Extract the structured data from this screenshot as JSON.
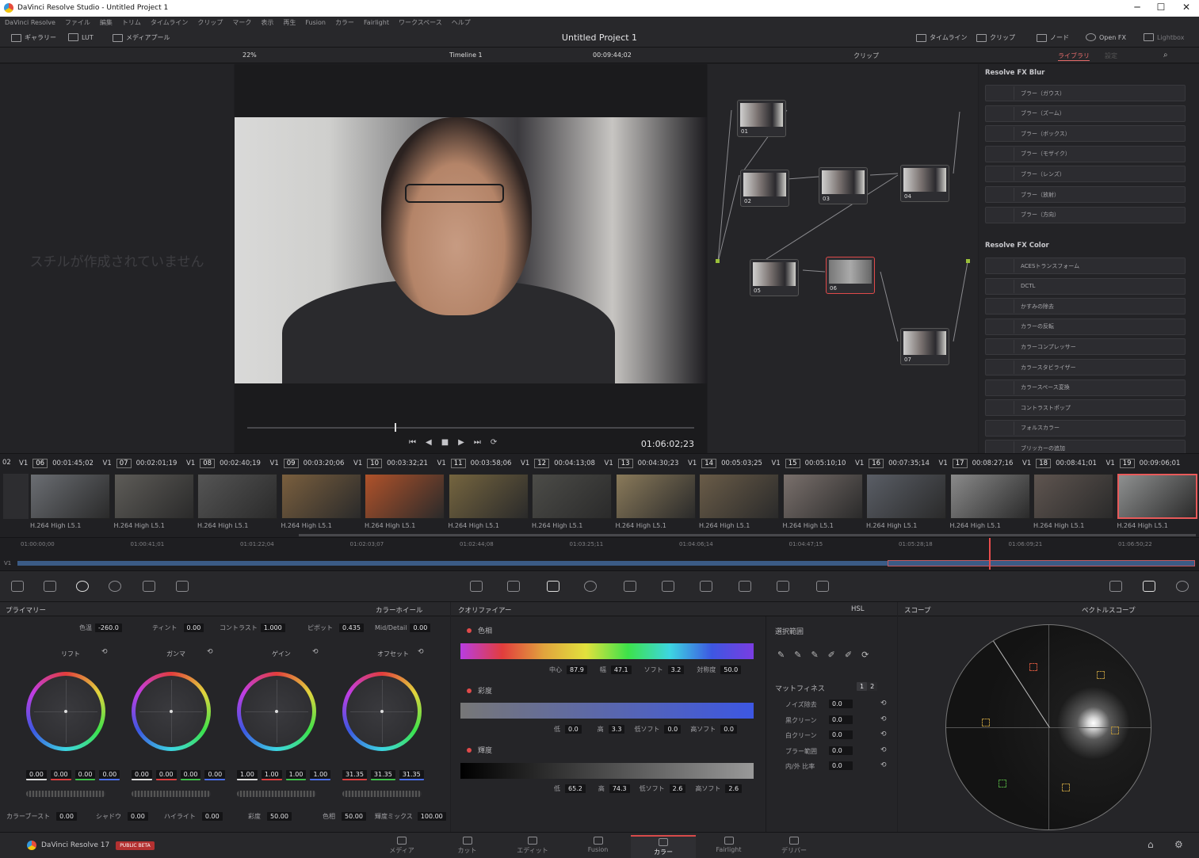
{
  "window": {
    "title": "DaVinci Resolve Studio - Untitled Project 1",
    "min": "─",
    "max": "☐",
    "close": "✕"
  },
  "menu": [
    "DaVinci Resolve",
    "ファイル",
    "編集",
    "トリム",
    "タイムライン",
    "クリップ",
    "マーク",
    "表示",
    "再生",
    "Fusion",
    "カラー",
    "Fairlight",
    "ワークスペース",
    "ヘルプ"
  ],
  "toolbar": {
    "gallery": "ギャラリー",
    "lut": "LUT",
    "media_pool": "メディアプール",
    "project_title": "Untitled Project 1",
    "timeline": "タイムライン",
    "clips": "クリップ",
    "nodes": "ノード",
    "openfx": "Open FX",
    "lightbox": "Lightbox"
  },
  "subbar": {
    "zoom": "22%",
    "timeline_name": "Timeline 1",
    "timecode": "00:09:44;02",
    "node_mode": "クリップ",
    "tab_library": "ライブラリ",
    "tab_settings": "設定"
  },
  "gallery": {
    "empty_message": "スチルが作成されていません"
  },
  "viewer": {
    "current_timecode": "01:06:02;23"
  },
  "nodes": [
    {
      "label": "01"
    },
    {
      "label": "02"
    },
    {
      "label": "03"
    },
    {
      "label": "04"
    },
    {
      "label": "05"
    },
    {
      "label": "06"
    },
    {
      "label": "07"
    }
  ],
  "library": {
    "blur_header": "Resolve FX Blur",
    "blur_items": [
      "ブラー（ガウス）",
      "ブラー（ズーム）",
      "ブラー（ボックス）",
      "ブラー（モザイク）",
      "ブラー（レンズ）",
      "ブラー（放射）",
      "ブラー（方向）"
    ],
    "color_header": "Resolve FX Color",
    "color_items": [
      "ACESトランスフォーム",
      "DCTL",
      "かすみの除去",
      "カラーの反転",
      "カラーコンプレッサー",
      "カラースタビライザー",
      "カラースペース変換",
      "コントラストポップ",
      "フォルスカラー",
      "ブリッカーの追加"
    ]
  },
  "clips": [
    {
      "track": "V1",
      "num": "06",
      "tc": "00:01:45;02",
      "codec": "H.264 High L5.1"
    },
    {
      "track": "V1",
      "num": "07",
      "tc": "00:02:01;19",
      "codec": "H.264 High L5.1"
    },
    {
      "track": "V1",
      "num": "08",
      "tc": "00:02:40;19",
      "codec": "H.264 High L5.1"
    },
    {
      "track": "V1",
      "num": "09",
      "tc": "00:03:20;06",
      "codec": "H.264 High L5.1"
    },
    {
      "track": "V1",
      "num": "10",
      "tc": "00:03:32;21",
      "codec": "H.264 High L5.1"
    },
    {
      "track": "V1",
      "num": "11",
      "tc": "00:03:58;06",
      "codec": "H.264 High L5.1"
    },
    {
      "track": "V1",
      "num": "12",
      "tc": "00:04:13;08",
      "codec": "H.264 High L5.1"
    },
    {
      "track": "V1",
      "num": "13",
      "tc": "00:04:30;23",
      "codec": "H.264 High L5.1"
    },
    {
      "track": "V1",
      "num": "14",
      "tc": "00:05:03;25",
      "codec": "H.264 High L5.1"
    },
    {
      "track": "V1",
      "num": "15",
      "tc": "00:05:10;10",
      "codec": "H.264 High L5.1"
    },
    {
      "track": "V1",
      "num": "16",
      "tc": "00:07:35;14",
      "codec": "H.264 High L5.1"
    },
    {
      "track": "V1",
      "num": "17",
      "tc": "00:08:27;16",
      "codec": "H.264 High L5.1"
    },
    {
      "track": "V1",
      "num": "18",
      "tc": "00:08:41;01",
      "codec": "H.264 High L5.1"
    },
    {
      "track": "V1",
      "num": "19",
      "tc": "00:09:06;01",
      "codec": "H.264 High L5.1"
    }
  ],
  "clip_prefix": "02",
  "mini_timeline": {
    "track": "V1",
    "ticks": [
      "01:00:00;00",
      "01:00:41;01",
      "01:01:22;04",
      "01:02:03;07",
      "01:02:44;08",
      "01:03:25;11",
      "01:04:06;14",
      "01:04:47;15",
      "01:05:28;18",
      "01:06:09;21",
      "01:06:50;22"
    ]
  },
  "primaries": {
    "title": "プライマリー",
    "mode": "カラーホイール",
    "temp_label": "色温",
    "temp": "-260.0",
    "tint_label": "ティント",
    "tint": "0.00",
    "contrast_label": "コントラスト",
    "contrast": "1.000",
    "pivot_label": "ピボット",
    "pivot": "0.435",
    "middetail_label": "Mid/Detail",
    "middetail": "0.00",
    "wheels": [
      {
        "name": "リフト",
        "values": [
          "0.00",
          "0.00",
          "0.00",
          "0.00"
        ]
      },
      {
        "name": "ガンマ",
        "values": [
          "0.00",
          "0.00",
          "0.00",
          "0.00"
        ]
      },
      {
        "name": "ゲイン",
        "values": [
          "1.00",
          "1.00",
          "1.00",
          "1.00"
        ]
      },
      {
        "name": "オフセット",
        "values": [
          "31.35",
          "31.35",
          "31.35"
        ]
      }
    ],
    "boost_label": "カラーブースト",
    "boost": "0.00",
    "shadow_label": "シャドウ",
    "shadow": "0.00",
    "highlight_label": "ハイライト",
    "highlight": "0.00",
    "sat_label": "彩度",
    "sat": "50.00",
    "hue_label": "色相",
    "hue": "50.00",
    "lummix_label": "輝度ミックス",
    "lummix": "100.00"
  },
  "qualifier": {
    "title": "クオリファイアー",
    "mode": "HSL",
    "hue_title": "色相",
    "hue": {
      "center_l": "中心",
      "center": "87.9",
      "width_l": "幅",
      "width": "47.1",
      "soft_l": "ソフト",
      "soft": "3.2",
      "sym_l": "対称度",
      "sym": "50.0"
    },
    "sat_title": "彩度",
    "sat": {
      "low_l": "低",
      "low": "0.0",
      "high_l": "高",
      "high": "3.3",
      "lsoft_l": "低ソフト",
      "lsoft": "0.0",
      "hsoft_l": "高ソフト",
      "hsoft": "0.0"
    },
    "lum_title": "輝度",
    "lum": {
      "low_l": "低",
      "low": "65.2",
      "high_l": "高",
      "high": "74.3",
      "lsoft_l": "低ソフト",
      "lsoft": "2.6",
      "hsoft_l": "高ソフト",
      "hsoft": "2.6"
    },
    "selection_title": "選択範囲",
    "matte_title": "マットフィネス",
    "matte_tabs": [
      "1",
      "2"
    ],
    "matte_rows": [
      {
        "label": "ノイズ除去",
        "value": "0.0"
      },
      {
        "label": "黒クリーン",
        "value": "0.0"
      },
      {
        "label": "白クリーン",
        "value": "0.0"
      },
      {
        "label": "ブラー範囲",
        "value": "0.0"
      },
      {
        "label": "内/外 比率",
        "value": "0.0"
      }
    ]
  },
  "scopes": {
    "title": "スコープ",
    "mode": "ベクトルスコープ"
  },
  "bottom": {
    "app": "DaVinci Resolve 17",
    "badge": "PUBLIC BETA",
    "pages": [
      "メディア",
      "カット",
      "エディット",
      "Fusion",
      "カラー",
      "Fairlight",
      "デリバー"
    ],
    "active_page": "カラー"
  }
}
